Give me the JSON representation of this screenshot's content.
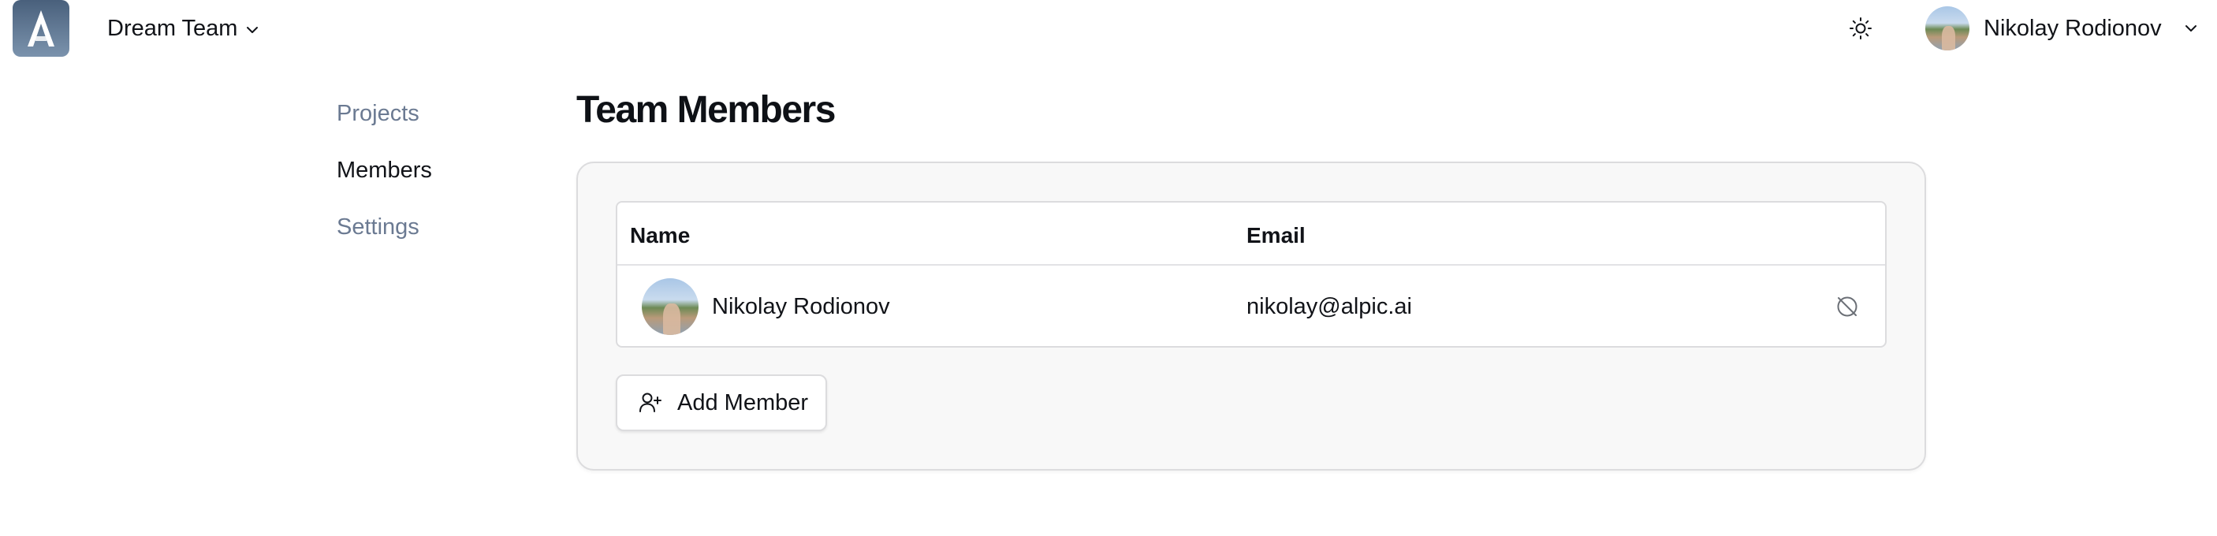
{
  "header": {
    "logo_icon": "app-logo-icon",
    "team_name": "Dream Team",
    "team_chevron_icon": "chevron-down-icon",
    "theme_icon": "sun-icon",
    "user_name": "Nikolay Rodionov",
    "user_chevron_icon": "chevron-down-icon"
  },
  "sidebar": {
    "items": [
      {
        "label": "Projects",
        "active": false
      },
      {
        "label": "Members",
        "active": true
      },
      {
        "label": "Settings",
        "active": false
      }
    ]
  },
  "main": {
    "title": "Team Members",
    "table": {
      "columns": [
        "Name",
        "Email"
      ],
      "rows": [
        {
          "name": "Nikolay Rodionov",
          "email": "nikolay@alpic.ai",
          "action_icon": "remove-member-icon"
        }
      ]
    },
    "add_member_label": "Add Member",
    "add_member_icon": "user-plus-icon"
  },
  "colors": {
    "muted_nav": "#6b7a92",
    "text": "#111318",
    "card_bg": "#f8f8f8",
    "border": "#dcdcde"
  }
}
